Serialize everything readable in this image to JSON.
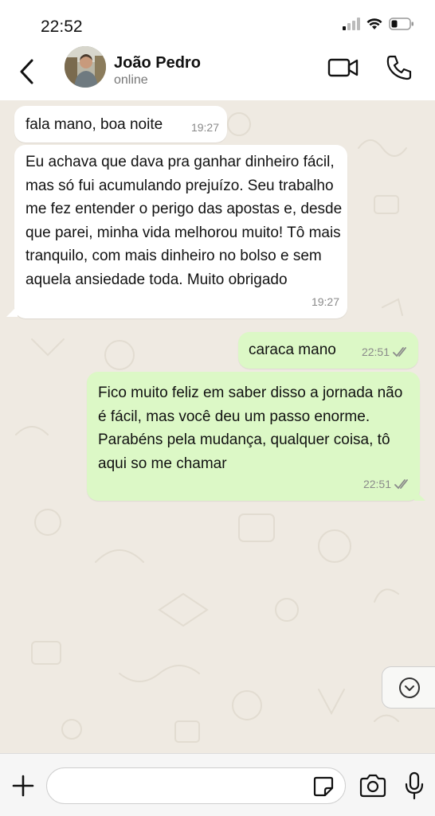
{
  "status_bar": {
    "time": "22:52"
  },
  "header": {
    "name": "João Pedro",
    "status": "online"
  },
  "messages": [
    {
      "direction": "in",
      "text": "fala mano, boa noite",
      "time": "19:27"
    },
    {
      "direction": "in",
      "text": "Eu achava que dava pra ganhar dinheiro fácil, mas só fui acumulando prejuízo. Seu trabalho me fez entender o perigo das apostas e, desde que parei, minha vida melhorou muito! Tô mais tranquilo, com mais dinheiro no bolso e sem aquela ansiedade toda. Muito obrigado",
      "time": "19:27"
    },
    {
      "direction": "out",
      "text": "caraca mano",
      "time": "22:51",
      "status": "read"
    },
    {
      "direction": "out",
      "text": "Fico muito feliz em saber disso a jornada não é fácil, mas você deu um passo enorme. Parabéns pela mudança, qualquer coisa, tô aqui so me chamar",
      "time": "22:51",
      "status": "read"
    }
  ],
  "input": {
    "value": "",
    "placeholder": ""
  },
  "colors": {
    "incoming_bubble": "#ffffff",
    "outgoing_bubble": "#dcf8c6",
    "wallpaper": "#efeae2",
    "read_ticks": "#8a8a8a"
  },
  "icons": [
    "back-arrow-icon",
    "video-call-icon",
    "phone-icon",
    "chevron-down-icon",
    "plus-icon",
    "sticker-icon",
    "camera-icon",
    "microphone-icon"
  ]
}
